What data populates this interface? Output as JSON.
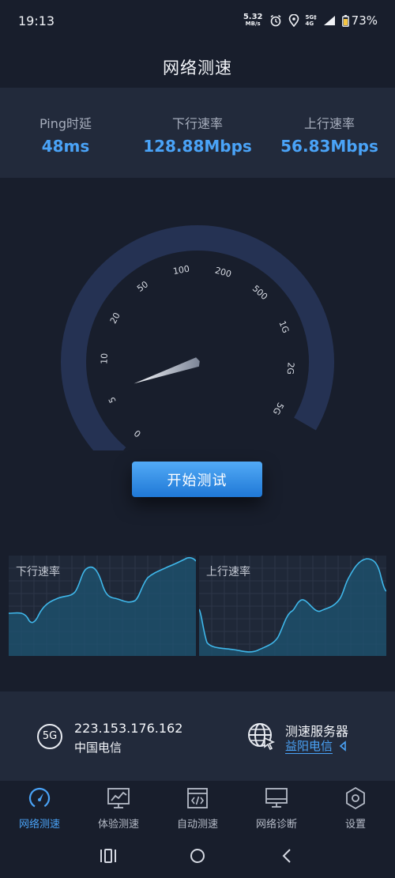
{
  "status_bar": {
    "time": "19:13",
    "net_speed_value": "5.32",
    "net_speed_unit": "MB/s",
    "signal_top": "5G‡",
    "signal_bottom": "4G",
    "battery": "73%"
  },
  "header": {
    "title": "网络测速"
  },
  "stats": [
    {
      "label": "Ping时延",
      "value": "48ms"
    },
    {
      "label": "下行速率",
      "value": "128.88Mbps"
    },
    {
      "label": "上行速率",
      "value": "56.83Mbps"
    }
  ],
  "gauge": {
    "ticks": [
      "0",
      "5",
      "10",
      "20",
      "50",
      "100",
      "200",
      "500",
      "1G",
      "2G",
      "5G"
    ],
    "needle_fraction": 0.12
  },
  "start_button": {
    "label": "开始测试"
  },
  "charts": {
    "download_label": "下行速率",
    "upload_label": "上行速率"
  },
  "network": {
    "type_badge": "5G",
    "ip": "223.153.176.162",
    "carrier": "中国电信",
    "server_title": "测速服务器",
    "server_name": "益阳电信"
  },
  "nav": [
    {
      "label": "网络测速",
      "icon": "speedometer-icon",
      "active": true
    },
    {
      "label": "体验测速",
      "icon": "chart-monitor-icon",
      "active": false
    },
    {
      "label": "自动测速",
      "icon": "code-file-icon",
      "active": false
    },
    {
      "label": "网络诊断",
      "icon": "monitor-icon",
      "active": false
    },
    {
      "label": "设置",
      "icon": "hexagon-gear-icon",
      "active": false
    }
  ],
  "colors": {
    "background": "#181e2c",
    "panel": "#222a3b",
    "accent": "#4aa3f7",
    "gauge_ring": "#253253"
  }
}
